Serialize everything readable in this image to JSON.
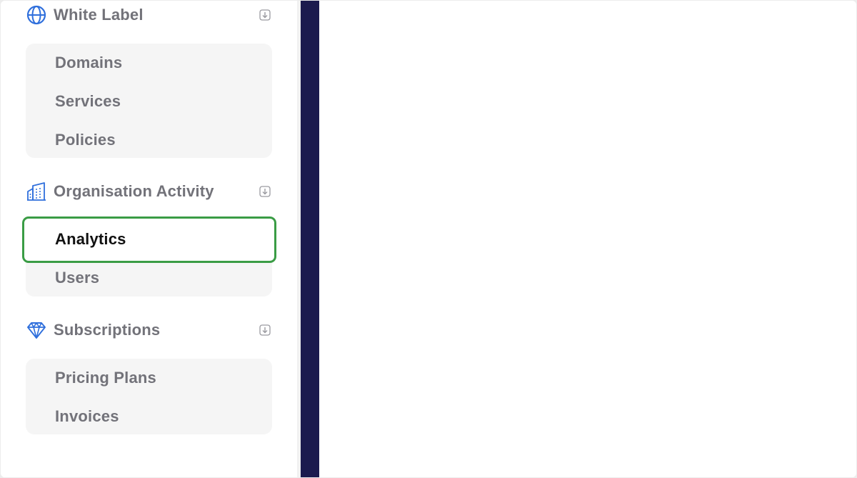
{
  "sidebar": {
    "sections": [
      {
        "title": "White Label",
        "icon": "globe-icon",
        "items": [
          {
            "label": "Domains"
          },
          {
            "label": "Services"
          },
          {
            "label": "Policies"
          }
        ]
      },
      {
        "title": "Organisation Activity",
        "icon": "building-icon",
        "items": [
          {
            "label": "Analytics",
            "active": true
          },
          {
            "label": "Users"
          }
        ]
      },
      {
        "title": "Subscriptions",
        "icon": "diamond-icon",
        "items": [
          {
            "label": "Pricing Plans"
          },
          {
            "label": "Invoices"
          }
        ]
      }
    ],
    "collapse_icon": "collapse-arrow-icon"
  },
  "colors": {
    "accent": "#2f6fdc",
    "text_muted": "#727279",
    "text_active": "#111111",
    "highlight": "#3a9c45",
    "dark_bar": "#1b1a4e",
    "submenu_bg": "#f5f5f5"
  }
}
